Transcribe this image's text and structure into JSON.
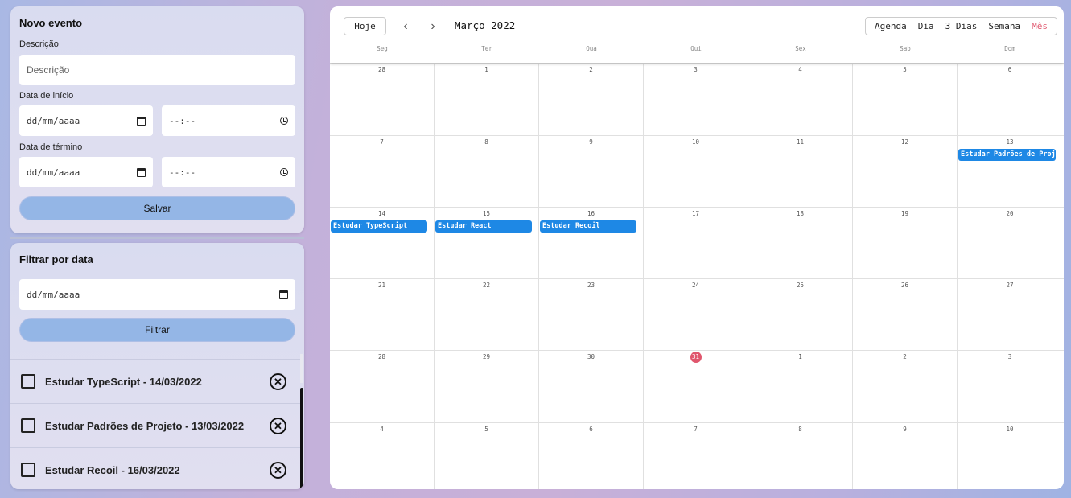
{
  "new_event": {
    "title": "Novo evento",
    "description_label": "Descrição",
    "description_placeholder": "Descrição",
    "start_label": "Data de início",
    "start_date_placeholder": "dd/mm/aaaa",
    "start_time_placeholder": "--:--",
    "end_label": "Data de término",
    "end_date_placeholder": "dd/mm/aaaa",
    "end_time_placeholder": "--:--",
    "save_label": "Salvar"
  },
  "filter": {
    "title": "Filtrar por data",
    "date_placeholder": "dd/mm/aaaa",
    "filter_label": "Filtrar"
  },
  "todos": [
    {
      "label": "Estudar TypeScript - 14/03/2022",
      "checked": false
    },
    {
      "label": "Estudar Padrões de Projeto - 13/03/2022",
      "checked": false
    },
    {
      "label": "Estudar Recoil - 16/03/2022",
      "checked": false
    }
  ],
  "calendar": {
    "today_label": "Hoje",
    "prev_icon": "chevron-left-icon",
    "next_icon": "chevron-right-icon",
    "month_title": "Março 2022",
    "views": [
      "Agenda",
      "Dia",
      "3 Dias",
      "Semana",
      "Mês"
    ],
    "active_view": "Mês",
    "weekdays": [
      "Seg",
      "Ter",
      "Qua",
      "Qui",
      "Sex",
      "Sab",
      "Dom"
    ],
    "weeks": [
      [
        "28",
        "1",
        "2",
        "3",
        "4",
        "5",
        "6"
      ],
      [
        "7",
        "8",
        "9",
        "10",
        "11",
        "12",
        "13"
      ],
      [
        "14",
        "15",
        "16",
        "17",
        "18",
        "19",
        "20"
      ],
      [
        "21",
        "22",
        "23",
        "24",
        "25",
        "26",
        "27"
      ],
      [
        "28",
        "29",
        "30",
        "31",
        "1",
        "2",
        "3"
      ],
      [
        "4",
        "5",
        "6",
        "7",
        "8",
        "9",
        "10"
      ]
    ],
    "today": {
      "week": 4,
      "day": 3
    },
    "events": [
      {
        "week": 1,
        "day": 6,
        "title": "Estudar Padrões de Projeto"
      },
      {
        "week": 2,
        "day": 0,
        "title": "Estudar TypeScript"
      },
      {
        "week": 2,
        "day": 1,
        "title": "Estudar React"
      },
      {
        "week": 2,
        "day": 2,
        "title": "Estudar Recoil"
      }
    ],
    "colors": {
      "event": "#1e88e5",
      "today": "#e0566d",
      "active_view": "#e0566d"
    }
  }
}
